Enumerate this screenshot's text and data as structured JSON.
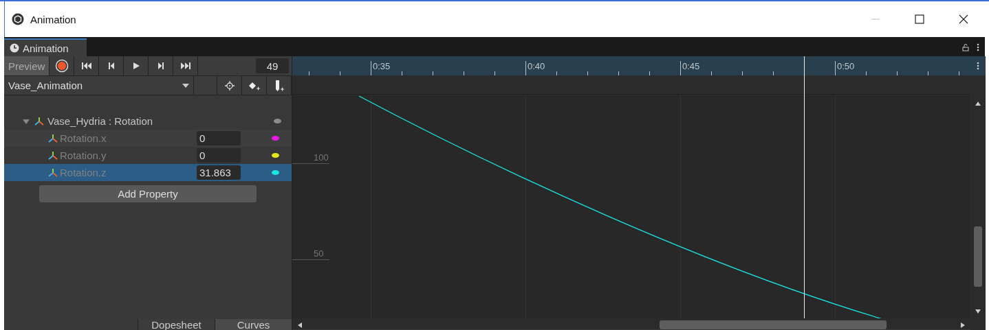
{
  "window": {
    "title": "Animation"
  },
  "tabs": [
    {
      "label": "Animation",
      "selected": true
    }
  ],
  "toolbar": {
    "preview": "Preview",
    "frame": "49"
  },
  "clip": {
    "name": "Vase_Animation"
  },
  "tree": [
    {
      "label": "Vase_Hydria : Rotation",
      "expanded": true,
      "color": "#8c8c8c",
      "children": [
        {
          "label": "Rotation.x",
          "value": "0",
          "color": "#e619e6",
          "selected": false
        },
        {
          "label": "Rotation.y",
          "value": "0",
          "color": "#e6e619",
          "selected": false
        },
        {
          "label": "Rotation.z",
          "value": "31.863",
          "color": "#19e6e6",
          "selected": true
        }
      ]
    }
  ],
  "add_property": "Add Property",
  "view_tabs": [
    {
      "label": "Dopesheet",
      "selected": false
    },
    {
      "label": "Curves",
      "selected": true
    }
  ],
  "timeline": {
    "labels": [
      "0:35",
      "0:40",
      "0:45",
      "0:50"
    ]
  },
  "curve_editor": {
    "value_labels": [
      "100",
      "50"
    ]
  }
}
